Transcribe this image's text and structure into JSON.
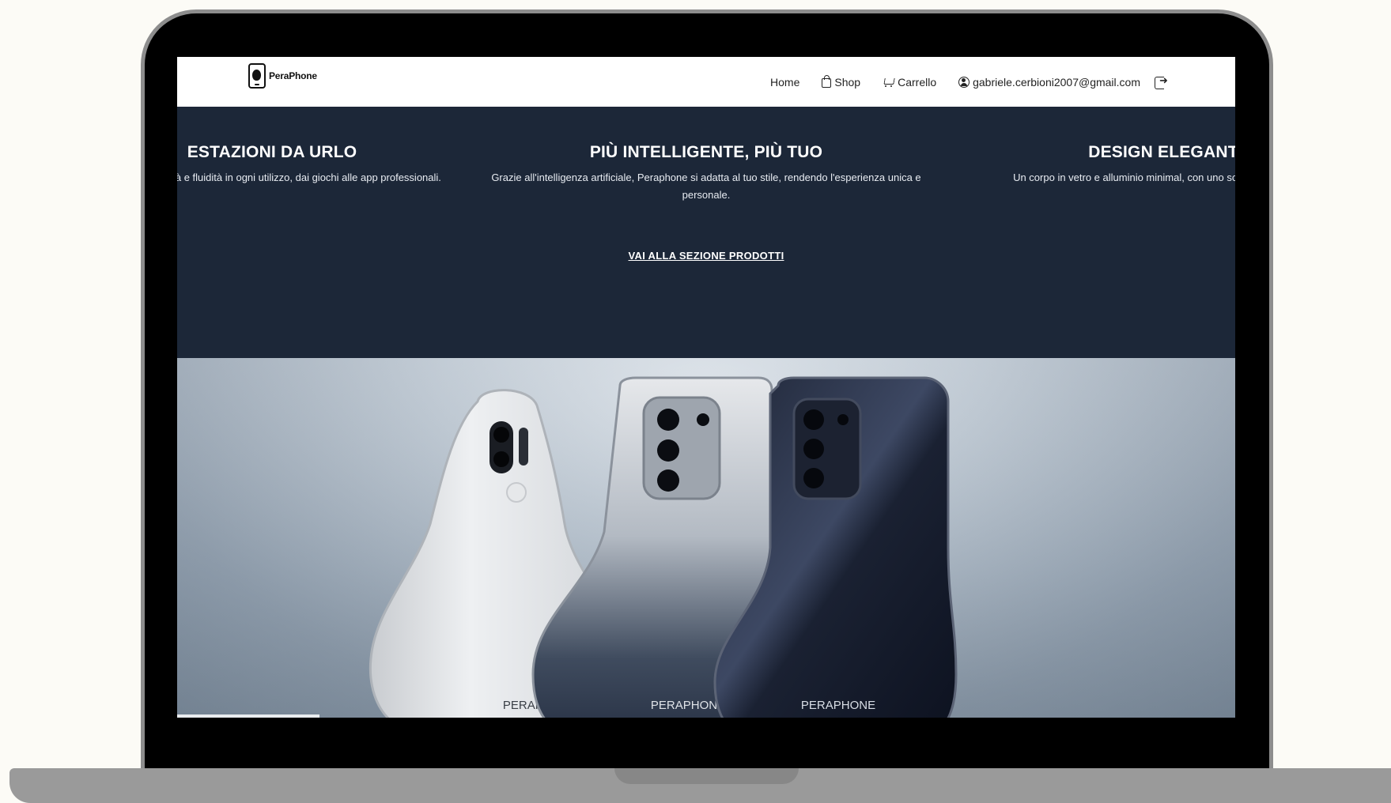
{
  "navbar": {
    "brand": "PeraPhone",
    "links": {
      "home": "Home",
      "shop": "Shop",
      "cart": "Carrello",
      "account": "gabriele.cerbioni2007@gmail.com"
    }
  },
  "features": [
    {
      "title": "ESTAZIONI DA URLO",
      "text": "garantire velocità e fluidità in ogni utilizzo, dai giochi alle app professionali."
    },
    {
      "title": "PIÙ INTELLIGENTE, PIÙ TUO",
      "text": "Grazie all'intelligenza artificiale, Peraphone si adatta al tuo stile, rendendo l'esperienza unica e personale."
    },
    {
      "title": "DESIGN ELEGANTI",
      "text": "Un corpo in vetro e alluminio minimal, con uno schermo ultra sottili."
    }
  ],
  "cta": "VAI ALLA SEZIONE PRODOTTI",
  "hero": {
    "phones": [
      {
        "label": "PERAPHONE",
        "color": "white"
      },
      {
        "label": "PERAPHONE",
        "color": "silver"
      },
      {
        "label": "PERAPHONE",
        "color": "midnight"
      }
    ]
  },
  "colors": {
    "band": "#1c2738",
    "frame": "#000000",
    "base": "#9a9a9a"
  }
}
